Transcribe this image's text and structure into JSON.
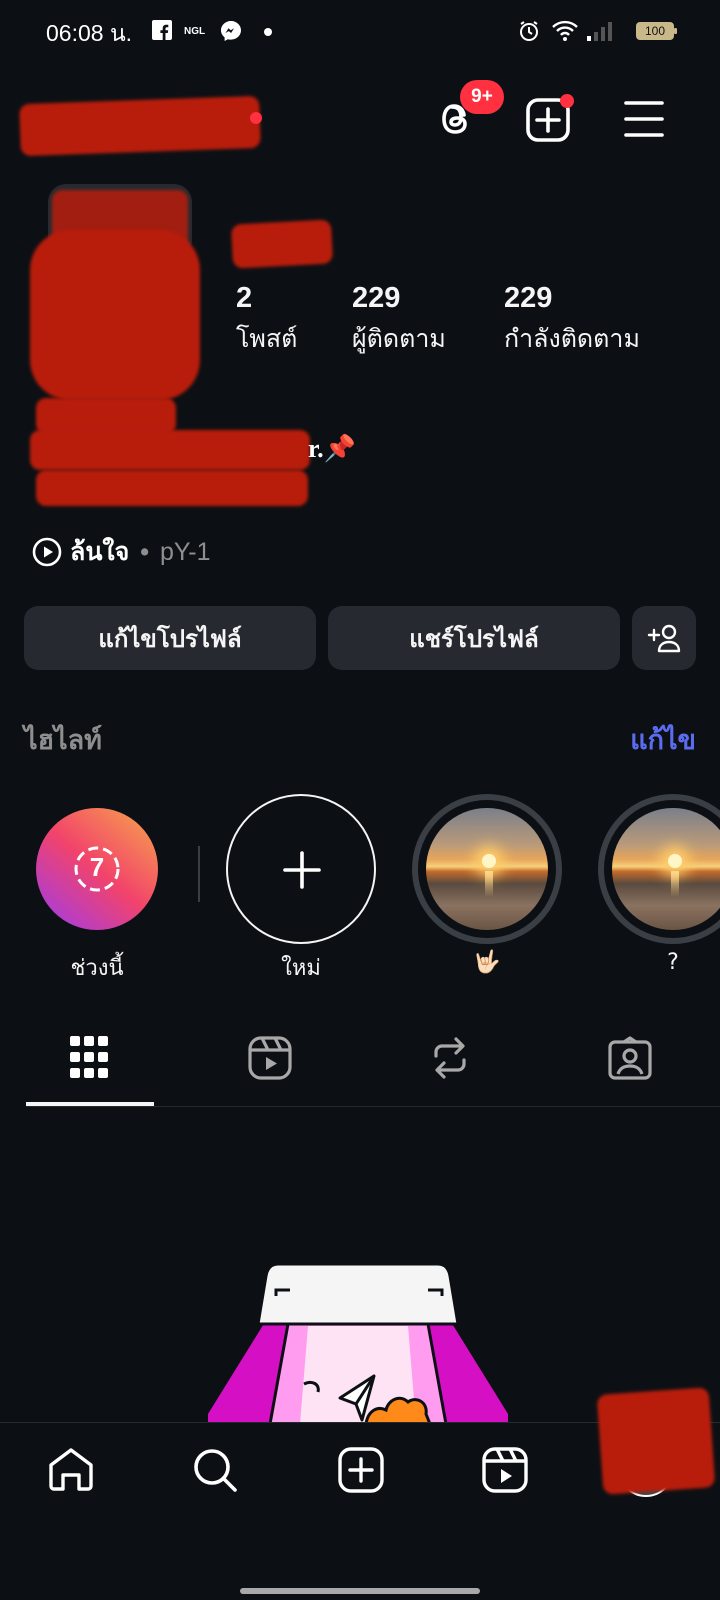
{
  "status_bar": {
    "time": "06:08 น.",
    "notification_icons": [
      "facebook-icon",
      "ngl-icon",
      "messenger-icon",
      "dot-icon"
    ],
    "system_icons": [
      "alarm-icon",
      "wifi-icon",
      "signal-icon",
      "battery-icon"
    ],
    "battery": "100"
  },
  "header": {
    "threads_badge": "9+",
    "accent_color": "#ff3040"
  },
  "profile": {
    "stats": [
      {
        "value": "2",
        "label": "โพสต์"
      },
      {
        "value": "229",
        "label": "ผู้ติดตาม"
      },
      {
        "value": "229",
        "label": "กำลังติดตาม"
      }
    ],
    "bio_visible_end": "r.📌",
    "music": {
      "title": "ล้นใจ",
      "separator": "•",
      "artist": "pY-1"
    }
  },
  "actions": {
    "edit_profile": "แก้ไขโปรไฟล์",
    "share_profile": "แชร์โปรไฟล์"
  },
  "highlights": {
    "heading": "ไฮไลท์",
    "edit_label": "แก้ไข",
    "recent_count": "7",
    "items": [
      {
        "label": "ช่วงนี้"
      },
      {
        "label": "ใหม่"
      },
      {
        "label": "🤟🏻"
      },
      {
        "label": "?"
      }
    ]
  },
  "tabs": [
    "grid-icon",
    "reels-icon",
    "reposts-icon",
    "tagged-icon"
  ],
  "bottom_nav": [
    "home-icon",
    "search-icon",
    "create-icon",
    "reels-icon",
    "profile-avatar"
  ],
  "link_color": "#5b6cf0"
}
